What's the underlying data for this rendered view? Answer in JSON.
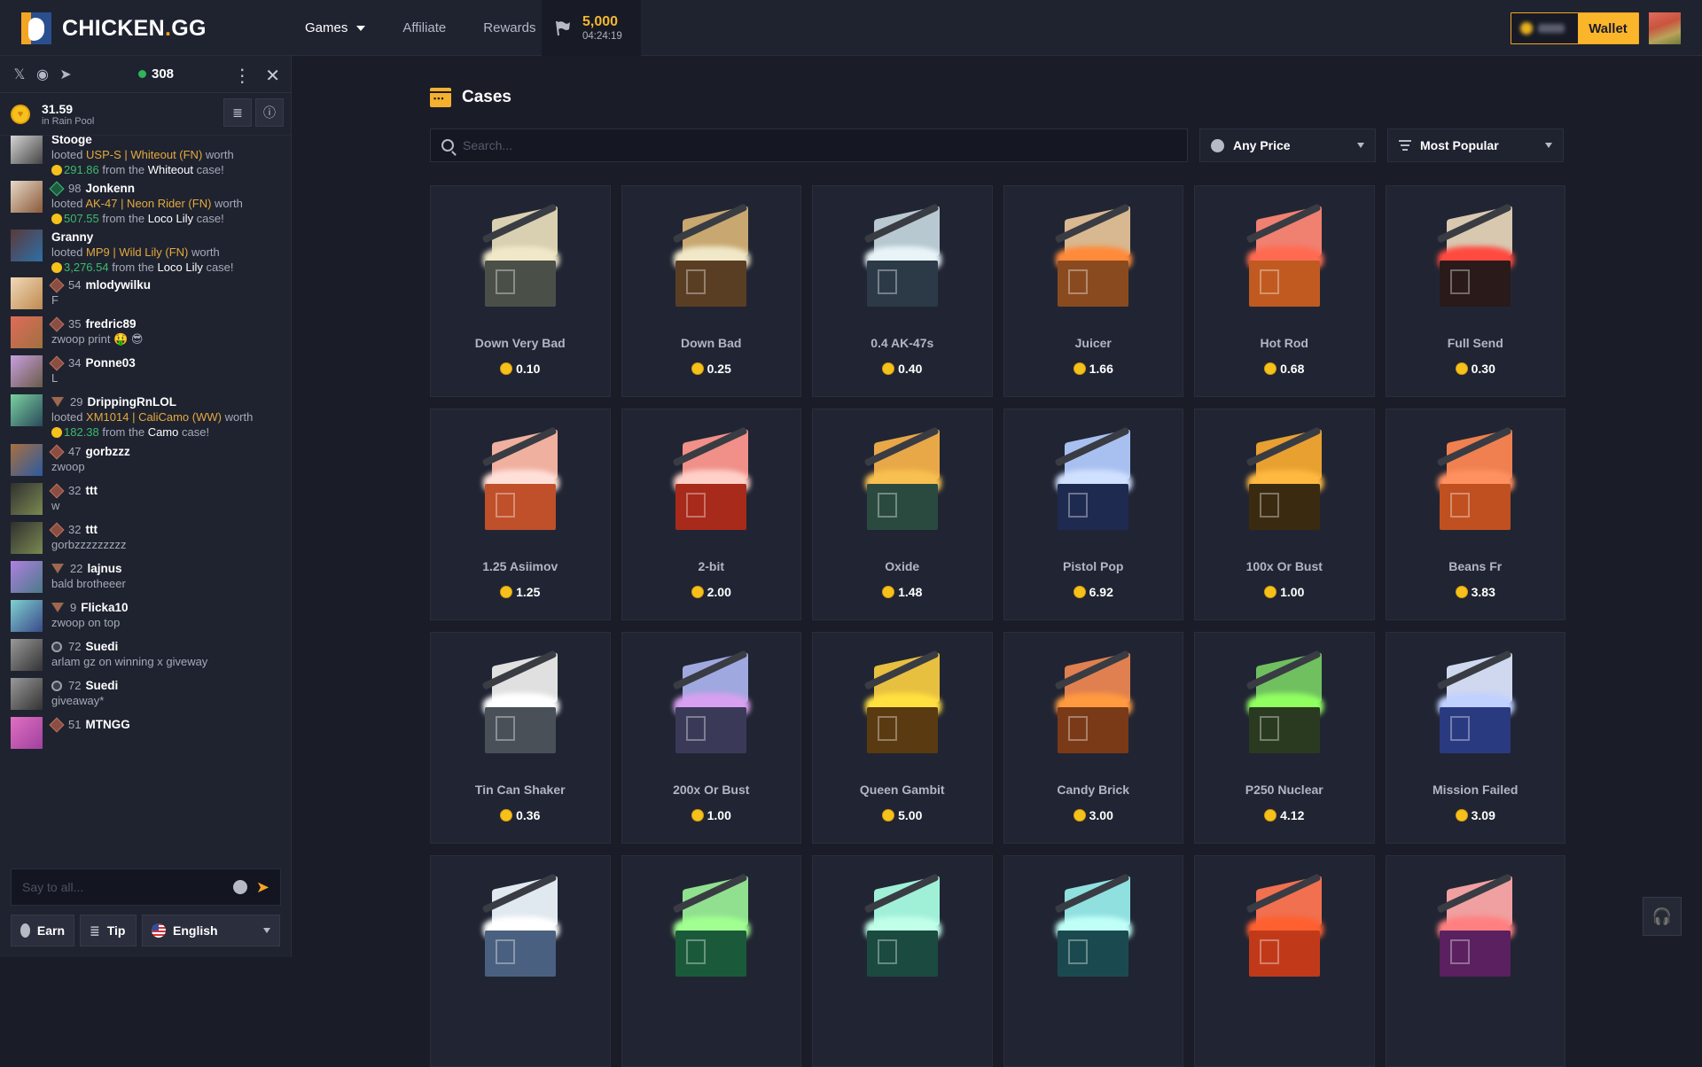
{
  "header": {
    "brand": "CHICKEN",
    "brand_dot": ".",
    "brand_suffix": "GG",
    "nav": [
      {
        "label": "Games",
        "has_dropdown": true
      },
      {
        "label": "Affiliate"
      },
      {
        "label": "Rewards"
      }
    ],
    "race": {
      "amount": "5,000",
      "timer": "04:24:19",
      "icon": "flag-icon"
    },
    "wallet_label": "Wallet",
    "wallet_balance": "hidden (blurred)"
  },
  "sidebar": {
    "social_icons": [
      "x-icon",
      "discord-icon",
      "telegram-icon"
    ],
    "online_count": "308",
    "rain": {
      "amount": "31.59",
      "label": "in Rain Pool"
    },
    "messages": [
      {
        "user": "Stooge",
        "level": "",
        "rank": "none",
        "type": "loot",
        "item": "USP-S",
        "skin": "Whiteout (FN)",
        "value": "291.86",
        "case": "Whiteout",
        "av": "linear-gradient(135deg,#ddd,#444)"
      },
      {
        "user": "Jonkenn",
        "level": "98",
        "rank": "green",
        "type": "loot",
        "item": "AK-47",
        "skin": "Neon Rider (FN)",
        "value": "507.55",
        "case": "Loco Lily",
        "av": "linear-gradient(135deg,#e8d8c8,#8a5a38)"
      },
      {
        "user": "Granny",
        "level": "",
        "rank": "none",
        "type": "loot",
        "item": "MP9",
        "skin": "Wild Lily (FN)",
        "value": "3,276.54",
        "case": "Loco Lily",
        "av": "linear-gradient(135deg,#5a3a3a,#2d6fa8)"
      },
      {
        "user": "mlodywilku",
        "level": "54",
        "rank": "diamond",
        "type": "text",
        "text": "F",
        "av": "linear-gradient(135deg,#f0d9b8,#c08a50)"
      },
      {
        "user": "fredric89",
        "level": "35",
        "rank": "diamond",
        "type": "text",
        "text": "zwoop print 🤑 😎",
        "av": "linear-gradient(135deg,#e06b5a,#a07040)"
      },
      {
        "user": "Ponne03",
        "level": "34",
        "rank": "diamond",
        "type": "text",
        "text": "L",
        "av": "linear-gradient(135deg,#c8a0e0,#6a5a48)"
      },
      {
        "user": "DrippingRnLOL",
        "level": "29",
        "rank": "tri",
        "type": "loot",
        "item": "XM1014",
        "skin": "CaliCamo (WW)",
        "value": "182.38",
        "case": "Camo",
        "av": "linear-gradient(135deg,#7ad0a0,#2a4a5a)"
      },
      {
        "user": "gorbzzz",
        "level": "47",
        "rank": "diamond",
        "type": "text",
        "text": "zwoop",
        "av": "linear-gradient(135deg,#a87040,#2c5aa0)"
      },
      {
        "user": "ttt",
        "level": "32",
        "rank": "diamond",
        "type": "text",
        "text": "w",
        "av": "linear-gradient(135deg,#303030,#7a8a50)"
      },
      {
        "user": "ttt",
        "level": "32",
        "rank": "diamond",
        "type": "text",
        "text": "gorbzzzzzzzzz",
        "av": "linear-gradient(135deg,#303030,#7a8a50)"
      },
      {
        "user": "lajnus",
        "level": "22",
        "rank": "tri",
        "type": "text",
        "text": "bald brotheeer",
        "av": "linear-gradient(135deg,#b080e0,#4a7a8a)"
      },
      {
        "user": "Flicka10",
        "level": "9",
        "rank": "tri",
        "type": "text",
        "text": "zwoop on top",
        "av": "linear-gradient(135deg,#80d0d0,#3a4a8a)"
      },
      {
        "user": "Suedi",
        "level": "72",
        "rank": "hex",
        "type": "text",
        "text": "arlam gz on winning x giveway",
        "av": "linear-gradient(135deg,#999,#333)"
      },
      {
        "user": "Suedi",
        "level": "72",
        "rank": "hex",
        "type": "text",
        "text": "giveaway*",
        "av": "linear-gradient(135deg,#999,#333)"
      },
      {
        "user": "MTNGG",
        "level": "51",
        "rank": "diamond",
        "type": "text",
        "text": "",
        "av": "linear-gradient(135deg,#e070c0,#a040a0)"
      }
    ],
    "loot_words": {
      "looted": "looted",
      "worth": "worth",
      "from_the": "from the",
      "case": "case!"
    },
    "chat_placeholder": "Say to all...",
    "buttons": {
      "earn": "Earn",
      "tip": "Tip",
      "language": "English"
    }
  },
  "main": {
    "title": "Cases",
    "search_placeholder": "Search...",
    "price_filter": "Any Price",
    "sort": "Most Popular",
    "cases": [
      {
        "name": "Down Very Bad",
        "price": "0.10",
        "lid": "#d8d0b0",
        "glow": "#f0e8c8",
        "box": "#4a5048"
      },
      {
        "name": "Down Bad",
        "price": "0.25",
        "lid": "#c8a870",
        "glow": "#f0e8c8",
        "box": "#5a3e24"
      },
      {
        "name": "0.4 AK-47s",
        "price": "0.40",
        "lid": "#b8c8d0",
        "glow": "#e8f4f8",
        "box": "#2c3a48"
      },
      {
        "name": "Juicer",
        "price": "1.66",
        "lid": "#d8b890",
        "glow": "#ff8a3a",
        "box": "#8a4a20"
      },
      {
        "name": "Hot Rod",
        "price": "0.68",
        "lid": "#f08070",
        "glow": "#ff6a50",
        "box": "#c05a20"
      },
      {
        "name": "Full Send",
        "price": "0.30",
        "lid": "#d8c8b0",
        "glow": "#ff4a40",
        "box": "#2a1a1a"
      },
      {
        "name": "1.25 Asiimov",
        "price": "1.25",
        "lid": "#f0b0a0",
        "glow": "#ffe0d8",
        "box": "#c0502a"
      },
      {
        "name": "2-bit",
        "price": "2.00",
        "lid": "#f09088",
        "glow": "#ffd0c8",
        "box": "#a82a1a"
      },
      {
        "name": "Oxide",
        "price": "1.48",
        "lid": "#e8a848",
        "glow": "#f8c050",
        "box": "#2a4a40"
      },
      {
        "name": "Pistol Pop",
        "price": "6.92",
        "lid": "#a8c0f0",
        "glow": "#d0e0ff",
        "box": "#1e2a50"
      },
      {
        "name": "100x Or Bust",
        "price": "1.00",
        "lid": "#e8a030",
        "glow": "#ffb840",
        "box": "#3a2a10"
      },
      {
        "name": "Beans Fr",
        "price": "3.83",
        "lid": "#f08050",
        "glow": "#ff9060",
        "box": "#c05020"
      },
      {
        "name": "Tin Can Shaker",
        "price": "0.36",
        "lid": "#e0e0e0",
        "glow": "#ffffff",
        "box": "#4a5058"
      },
      {
        "name": "200x Or Bust",
        "price": "1.00",
        "lid": "#a0a8e0",
        "glow": "#d8a0f0",
        "box": "#3a3a58"
      },
      {
        "name": "Queen Gambit",
        "price": "5.00",
        "lid": "#e8c040",
        "glow": "#ffe040",
        "box": "#5a3a10"
      },
      {
        "name": "Candy Brick",
        "price": "3.00",
        "lid": "#e08050",
        "glow": "#ff9a40",
        "box": "#7a3a18"
      },
      {
        "name": "P250 Nuclear",
        "price": "4.12",
        "lid": "#70c060",
        "glow": "#90ff60",
        "box": "#2a3a20"
      },
      {
        "name": "Mission Failed",
        "price": "3.09",
        "lid": "#d0d8f0",
        "glow": "#c0d0ff",
        "box": "#2a3a80"
      },
      {
        "name": "",
        "price": "",
        "lid": "#e0e8f0",
        "glow": "#ffffff",
        "box": "#4a6080"
      },
      {
        "name": "",
        "price": "",
        "lid": "#90e090",
        "glow": "#a0ff90",
        "box": "#1a5a3a"
      },
      {
        "name": "",
        "price": "",
        "lid": "#a0f0d8",
        "glow": "#c0ffe8",
        "box": "#1a4a40"
      },
      {
        "name": "",
        "price": "",
        "lid": "#90e0e0",
        "glow": "#c0fff8",
        "box": "#1a4a50"
      },
      {
        "name": "",
        "price": "",
        "lid": "#f07050",
        "glow": "#ff6030",
        "box": "#c03a1a"
      },
      {
        "name": "",
        "price": "",
        "lid": "#f0a0a0",
        "glow": "#ff8080",
        "box": "#5a2060"
      }
    ]
  },
  "support_icon": "headset-icon"
}
